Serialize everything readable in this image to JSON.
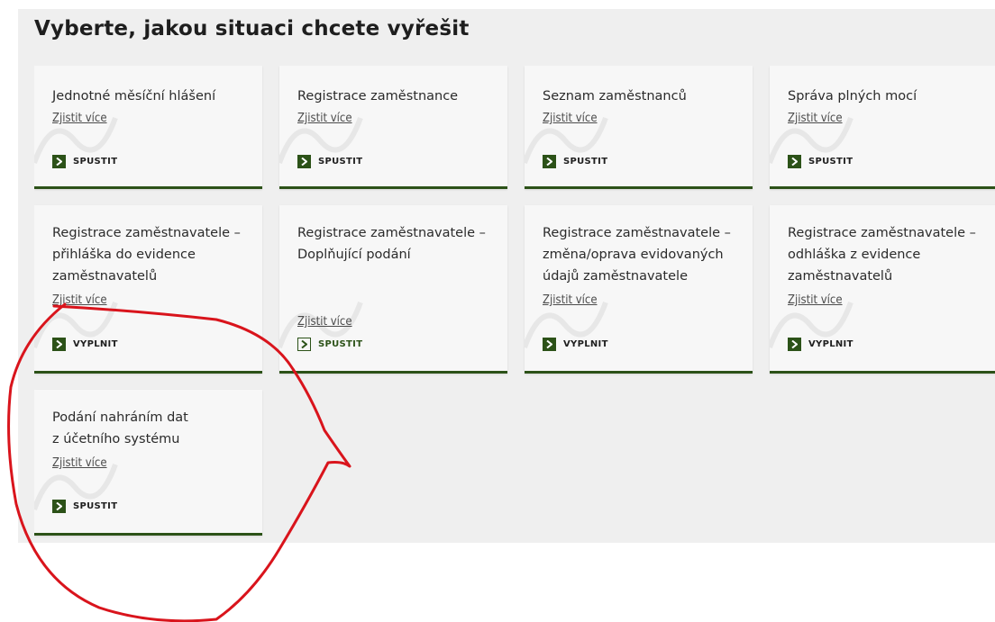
{
  "heading": "Vyberte, jakou situaci chcete vyřešit",
  "more_label": "Zjistit více",
  "cards": [
    {
      "title": "Jednotné měsíční hlášení",
      "action": "SPUSTIT"
    },
    {
      "title": "Registrace zaměstnance",
      "action": "SPUSTIT"
    },
    {
      "title": "Seznam zaměstnanců",
      "action": "SPUSTIT"
    },
    {
      "title": "Správa plných mocí",
      "action": "SPUSTIT"
    },
    {
      "title": "Registrace zaměstnavatele – přihláška do evidence zaměstnavatelů",
      "action": "VYPLNIT"
    },
    {
      "title": "Registrace zaměstnavatele – Doplňující podání",
      "action": "SPUSTIT"
    },
    {
      "title": "Registrace zaměstnavatele – změna/oprava evidovaných údajů zaměstnavatele",
      "action": "VYPLNIT"
    },
    {
      "title": "Registrace zaměstnavatele – odhláška z evidence zaměstnavatelů",
      "action": "VYPLNIT"
    },
    {
      "title": "Podání nahráním dat z účetního systému",
      "action": "SPUSTIT"
    }
  ],
  "colors": {
    "accent": "#2c5218",
    "annotation": "#d9141c",
    "panel_bg": "#efefef",
    "card_bg": "#f7f7f7"
  },
  "icons": {
    "action": "chevron-right-icon"
  }
}
